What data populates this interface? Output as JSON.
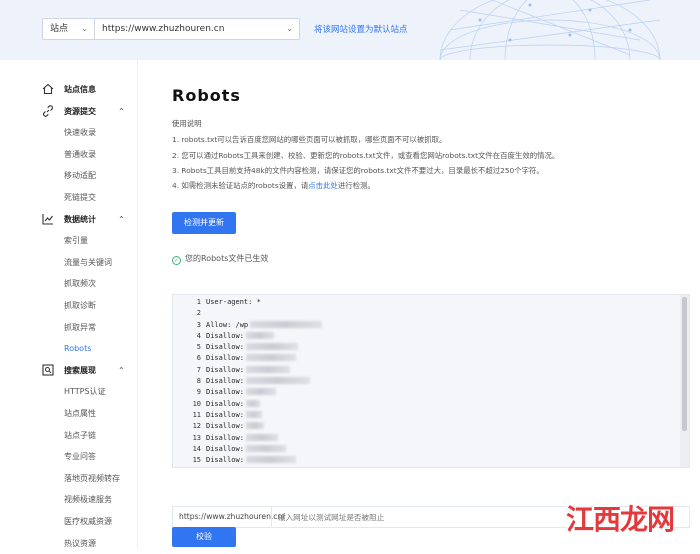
{
  "header": {
    "site_select": "站点",
    "site_url": "https://www.zhuzhouren.cn",
    "set_default_link": "将该网站设置为默认站点"
  },
  "sidebar": {
    "items": [
      {
        "label": "站点信息",
        "type": "group",
        "icon": "home-icon"
      },
      {
        "label": "资源提交",
        "type": "group",
        "icon": "link-icon",
        "expanded": true
      },
      {
        "label": "快速收录",
        "type": "sub"
      },
      {
        "label": "普通收录",
        "type": "sub"
      },
      {
        "label": "移动适配",
        "type": "sub"
      },
      {
        "label": "死链提交",
        "type": "sub"
      },
      {
        "label": "数据统计",
        "type": "group",
        "icon": "chart-icon",
        "expanded": true
      },
      {
        "label": "索引量",
        "type": "sub"
      },
      {
        "label": "流量与关键词",
        "type": "sub"
      },
      {
        "label": "抓取频次",
        "type": "sub"
      },
      {
        "label": "抓取诊断",
        "type": "sub"
      },
      {
        "label": "抓取异常",
        "type": "sub"
      },
      {
        "label": "Robots",
        "type": "sub",
        "active": true
      },
      {
        "label": "搜索展现",
        "type": "group",
        "icon": "search-display-icon",
        "expanded": true
      },
      {
        "label": "HTTPS认证",
        "type": "sub"
      },
      {
        "label": "站点属性",
        "type": "sub"
      },
      {
        "label": "站点子链",
        "type": "sub"
      },
      {
        "label": "专业问答",
        "type": "sub"
      },
      {
        "label": "落地页视频转存",
        "type": "sub"
      },
      {
        "label": "视频极速服务",
        "type": "sub"
      },
      {
        "label": "医疗权威资源",
        "type": "sub"
      },
      {
        "label": "热议资源",
        "type": "sub"
      }
    ]
  },
  "main": {
    "title": "Robots",
    "usage_heading": "使用说明",
    "lines": [
      "1. robots.txt可以告诉百度您网站的哪些页面可以被抓取，哪些页面不可以被抓取。",
      "2. 您可以通过Robots工具来创建、校验、更新您的robots.txt文件，或查看您网站robots.txt文件在百度生效的情况。",
      "3. Robots工具目前支持48k的文件内容检测，请保证您的robots.txt文件不要过大，目录最长不超过250个字符。"
    ],
    "line4_before": "4. 如需检测未验证站点的robots设置，请",
    "line4_link": "点击此处",
    "line4_after": "进行检测。",
    "check_button": "检测并更新",
    "status_text": "您的Robots文件已生效",
    "code_lines": [
      {
        "num": "1",
        "text": "User-agent: *",
        "blur": 0
      },
      {
        "num": "2",
        "text": "",
        "blur": 0
      },
      {
        "num": "3",
        "text": "Allow: /wp",
        "blur": 72
      },
      {
        "num": "4",
        "text": "Disallow:",
        "blur": 28
      },
      {
        "num": "5",
        "text": "Disallow:",
        "blur": 52
      },
      {
        "num": "6",
        "text": "Disallow:",
        "blur": 50
      },
      {
        "num": "7",
        "text": "Disallow:",
        "blur": 44
      },
      {
        "num": "8",
        "text": "Disallow:",
        "blur": 64
      },
      {
        "num": "9",
        "text": "Disallow:",
        "blur": 30
      },
      {
        "num": "10",
        "text": "Disallow:",
        "blur": 14
      },
      {
        "num": "11",
        "text": "Disallow:",
        "blur": 16
      },
      {
        "num": "12",
        "text": "Disallow:",
        "blur": 18
      },
      {
        "num": "13",
        "text": "Disallow:",
        "blur": 32
      },
      {
        "num": "14",
        "text": "Disallow:",
        "blur": 40
      },
      {
        "num": "15",
        "text": "Disallow:",
        "blur": 50
      }
    ],
    "url_prefix": "https://www.zhuzhouren.cn/",
    "url_placeholder": "输入网址以测试网址是否被阻止",
    "verify_button": "校验"
  },
  "watermark": "江西龙网",
  "colors": {
    "accent": "#3275f0",
    "success": "#3cb371",
    "watermark": "#e4393c"
  }
}
